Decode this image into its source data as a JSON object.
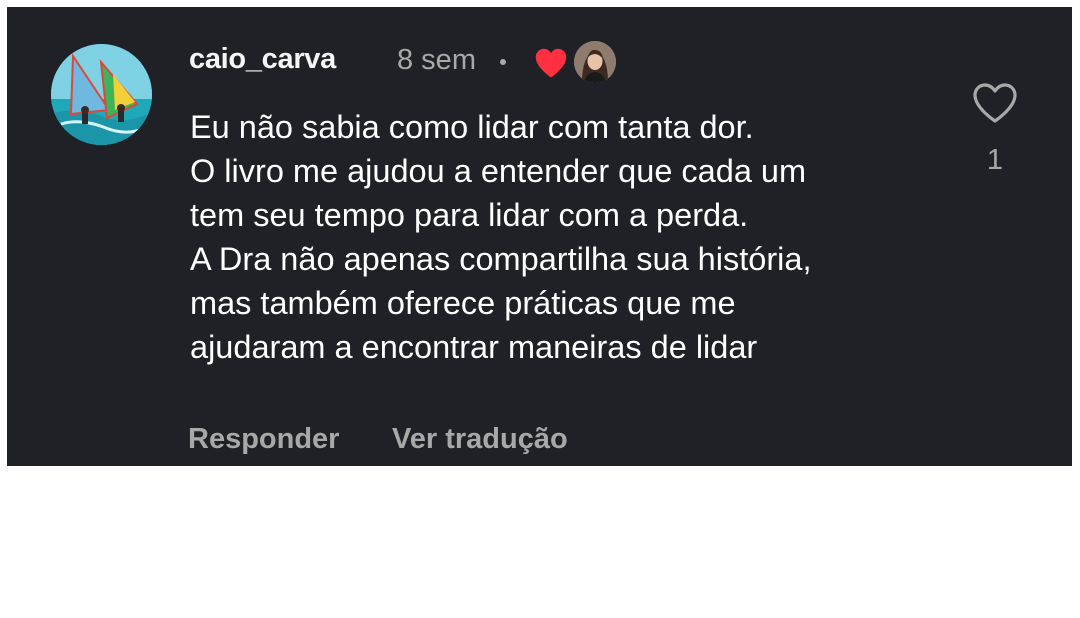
{
  "comment": {
    "username": "caio_carva",
    "timestamp": "8 sem",
    "separator": "•",
    "liked_by_author": true,
    "text_lines": [
      "Eu não sabia como lidar com tanta dor.",
      "O livro me ajudou a entender que cada um",
      "tem seu tempo para lidar com a perda.",
      "A Dra não apenas compartilha sua história,",
      "mas também oferece práticas que me",
      "ajudaram a encontrar maneiras de lidar"
    ],
    "like_count": "1"
  },
  "actions": {
    "reply_label": "Responder",
    "translate_label": "Ver tradução"
  },
  "icons": {
    "author_like": "heart-filled-icon",
    "like": "heart-outline-icon"
  },
  "colors": {
    "background": "#1f2126",
    "username": "#f5f5f5",
    "text": "#ffffff",
    "muted": "#a8a8a8",
    "heart_red": "#ff3040"
  }
}
